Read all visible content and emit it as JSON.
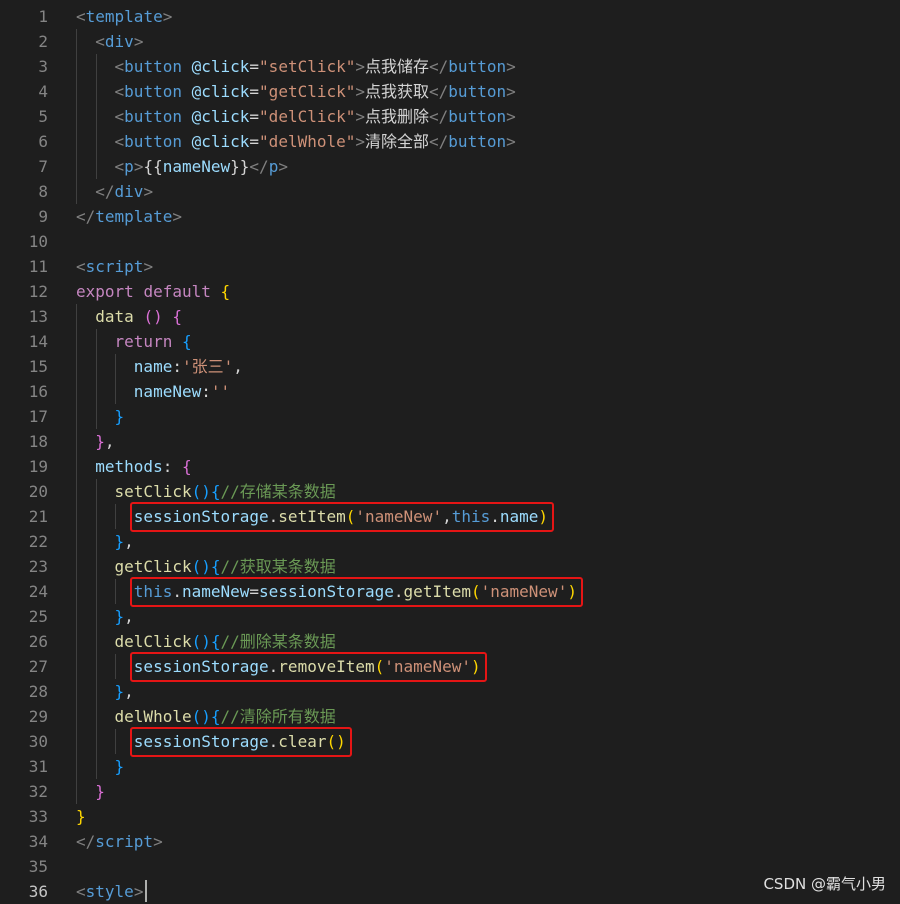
{
  "editor": {
    "lines": [
      {
        "n": "1",
        "t": [
          [
            "<",
            "punc"
          ],
          [
            "template",
            "tag"
          ],
          [
            ">",
            "punc"
          ]
        ]
      },
      {
        "n": "2",
        "t": [
          [
            "  ",
            "text"
          ],
          [
            "<",
            "punc"
          ],
          [
            "div",
            "tag"
          ],
          [
            ">",
            "punc"
          ]
        ]
      },
      {
        "n": "3",
        "t": [
          [
            "    ",
            "text"
          ],
          [
            "<",
            "punc"
          ],
          [
            "button",
            "tag"
          ],
          [
            " ",
            "text"
          ],
          [
            "@click",
            "attr"
          ],
          [
            "=",
            "text"
          ],
          [
            "\"setClick\"",
            "str"
          ],
          [
            ">",
            "punc"
          ],
          [
            "点我储存",
            "text"
          ],
          [
            "</",
            "punc"
          ],
          [
            "button",
            "tag"
          ],
          [
            ">",
            "punc"
          ]
        ]
      },
      {
        "n": "4",
        "t": [
          [
            "    ",
            "text"
          ],
          [
            "<",
            "punc"
          ],
          [
            "button",
            "tag"
          ],
          [
            " ",
            "text"
          ],
          [
            "@click",
            "attr"
          ],
          [
            "=",
            "text"
          ],
          [
            "\"getClick\"",
            "str"
          ],
          [
            ">",
            "punc"
          ],
          [
            "点我获取",
            "text"
          ],
          [
            "</",
            "punc"
          ],
          [
            "button",
            "tag"
          ],
          [
            ">",
            "punc"
          ]
        ]
      },
      {
        "n": "5",
        "t": [
          [
            "    ",
            "text"
          ],
          [
            "<",
            "punc"
          ],
          [
            "button",
            "tag"
          ],
          [
            " ",
            "text"
          ],
          [
            "@click",
            "attr"
          ],
          [
            "=",
            "text"
          ],
          [
            "\"delClick\"",
            "str"
          ],
          [
            ">",
            "punc"
          ],
          [
            "点我删除",
            "text"
          ],
          [
            "</",
            "punc"
          ],
          [
            "button",
            "tag"
          ],
          [
            ">",
            "punc"
          ]
        ]
      },
      {
        "n": "6",
        "t": [
          [
            "    ",
            "text"
          ],
          [
            "<",
            "punc"
          ],
          [
            "button",
            "tag"
          ],
          [
            " ",
            "text"
          ],
          [
            "@click",
            "attr"
          ],
          [
            "=",
            "text"
          ],
          [
            "\"delWhole\"",
            "str"
          ],
          [
            ">",
            "punc"
          ],
          [
            "清除全部",
            "text"
          ],
          [
            "</",
            "punc"
          ],
          [
            "button",
            "tag"
          ],
          [
            ">",
            "punc"
          ]
        ]
      },
      {
        "n": "7",
        "t": [
          [
            "    ",
            "text"
          ],
          [
            "<",
            "punc"
          ],
          [
            "p",
            "tag"
          ],
          [
            ">",
            "punc"
          ],
          [
            "{{",
            "text"
          ],
          [
            "nameNew",
            "var"
          ],
          [
            "}}",
            "text"
          ],
          [
            "</",
            "punc"
          ],
          [
            "p",
            "tag"
          ],
          [
            ">",
            "punc"
          ]
        ]
      },
      {
        "n": "8",
        "t": [
          [
            "  ",
            "text"
          ],
          [
            "</",
            "punc"
          ],
          [
            "div",
            "tag"
          ],
          [
            ">",
            "punc"
          ]
        ]
      },
      {
        "n": "9",
        "t": [
          [
            "</",
            "punc"
          ],
          [
            "template",
            "tag"
          ],
          [
            ">",
            "punc"
          ]
        ]
      },
      {
        "n": "10",
        "t": []
      },
      {
        "n": "11",
        "t": [
          [
            "<",
            "punc"
          ],
          [
            "script",
            "tag"
          ],
          [
            ">",
            "punc"
          ]
        ]
      },
      {
        "n": "12",
        "t": [
          [
            "export",
            "kw"
          ],
          [
            " ",
            "text"
          ],
          [
            "default",
            "kw"
          ],
          [
            " ",
            "text"
          ],
          [
            "{",
            "b1"
          ]
        ]
      },
      {
        "n": "13",
        "t": [
          [
            "  ",
            "text"
          ],
          [
            "data",
            "fn"
          ],
          [
            " ",
            "text"
          ],
          [
            "()",
            "b2"
          ],
          [
            " ",
            "text"
          ],
          [
            "{",
            "b2"
          ]
        ]
      },
      {
        "n": "14",
        "t": [
          [
            "    ",
            "text"
          ],
          [
            "return",
            "kw"
          ],
          [
            " ",
            "text"
          ],
          [
            "{",
            "b3"
          ]
        ]
      },
      {
        "n": "15",
        "t": [
          [
            "      ",
            "text"
          ],
          [
            "name",
            "var"
          ],
          [
            ":",
            "text"
          ],
          [
            "'张三'",
            "str"
          ],
          [
            ",",
            "text"
          ]
        ]
      },
      {
        "n": "16",
        "t": [
          [
            "      ",
            "text"
          ],
          [
            "nameNew",
            "var"
          ],
          [
            ":",
            "text"
          ],
          [
            "''",
            "str"
          ]
        ]
      },
      {
        "n": "17",
        "t": [
          [
            "    ",
            "text"
          ],
          [
            "}",
            "b3"
          ]
        ]
      },
      {
        "n": "18",
        "t": [
          [
            "  ",
            "text"
          ],
          [
            "}",
            "b2"
          ],
          [
            ",",
            "text"
          ]
        ]
      },
      {
        "n": "19",
        "t": [
          [
            "  ",
            "text"
          ],
          [
            "methods",
            "var"
          ],
          [
            ": ",
            "text"
          ],
          [
            "{",
            "b2"
          ]
        ]
      },
      {
        "n": "20",
        "t": [
          [
            "    ",
            "text"
          ],
          [
            "setClick",
            "fn"
          ],
          [
            "()",
            "b3"
          ],
          [
            "{",
            "b3"
          ],
          [
            "//存储某条数据",
            "com"
          ]
        ]
      },
      {
        "n": "21",
        "t": [
          [
            "      ",
            "text"
          ],
          [
            "sessionStorage",
            "var"
          ],
          [
            ".",
            "text"
          ],
          [
            "setItem",
            "fn"
          ],
          [
            "(",
            "b1"
          ],
          [
            "'nameNew'",
            "str"
          ],
          [
            ",",
            "text"
          ],
          [
            "this",
            "kwb"
          ],
          [
            ".",
            "text"
          ],
          [
            "name",
            "var"
          ],
          [
            ")",
            "b1"
          ]
        ]
      },
      {
        "n": "22",
        "t": [
          [
            "    ",
            "text"
          ],
          [
            "}",
            "b3"
          ],
          [
            ",",
            "text"
          ]
        ]
      },
      {
        "n": "23",
        "t": [
          [
            "    ",
            "text"
          ],
          [
            "getClick",
            "fn"
          ],
          [
            "()",
            "b3"
          ],
          [
            "{",
            "b3"
          ],
          [
            "//获取某条数据",
            "com"
          ]
        ]
      },
      {
        "n": "24",
        "t": [
          [
            "      ",
            "text"
          ],
          [
            "this",
            "kwb"
          ],
          [
            ".",
            "text"
          ],
          [
            "nameNew",
            "var"
          ],
          [
            "=",
            "text"
          ],
          [
            "sessionStorage",
            "var"
          ],
          [
            ".",
            "text"
          ],
          [
            "getItem",
            "fn"
          ],
          [
            "(",
            "b1"
          ],
          [
            "'nameNew'",
            "str"
          ],
          [
            ")",
            "b1"
          ]
        ]
      },
      {
        "n": "25",
        "t": [
          [
            "    ",
            "text"
          ],
          [
            "}",
            "b3"
          ],
          [
            ",",
            "text"
          ]
        ]
      },
      {
        "n": "26",
        "t": [
          [
            "    ",
            "text"
          ],
          [
            "delClick",
            "fn"
          ],
          [
            "()",
            "b3"
          ],
          [
            "{",
            "b3"
          ],
          [
            "//删除某条数据",
            "com"
          ]
        ]
      },
      {
        "n": "27",
        "t": [
          [
            "      ",
            "text"
          ],
          [
            "sessionStorage",
            "var"
          ],
          [
            ".",
            "text"
          ],
          [
            "removeItem",
            "fn"
          ],
          [
            "(",
            "b1"
          ],
          [
            "'nameNew'",
            "str"
          ],
          [
            ")",
            "b1"
          ]
        ]
      },
      {
        "n": "28",
        "t": [
          [
            "    ",
            "text"
          ],
          [
            "}",
            "b3"
          ],
          [
            ",",
            "text"
          ]
        ]
      },
      {
        "n": "29",
        "t": [
          [
            "    ",
            "text"
          ],
          [
            "delWhole",
            "fn"
          ],
          [
            "()",
            "b3"
          ],
          [
            "{",
            "b3"
          ],
          [
            "//清除所有数据",
            "com"
          ]
        ]
      },
      {
        "n": "30",
        "t": [
          [
            "      ",
            "text"
          ],
          [
            "sessionStorage",
            "var"
          ],
          [
            ".",
            "text"
          ],
          [
            "clear",
            "fn"
          ],
          [
            "()",
            "b1"
          ]
        ]
      },
      {
        "n": "31",
        "t": [
          [
            "    ",
            "text"
          ],
          [
            "}",
            "b3"
          ]
        ]
      },
      {
        "n": "32",
        "t": [
          [
            "  ",
            "text"
          ],
          [
            "}",
            "b2"
          ]
        ]
      },
      {
        "n": "33",
        "t": [
          [
            "}",
            "b1"
          ]
        ]
      },
      {
        "n": "34",
        "t": [
          [
            "</",
            "punc"
          ],
          [
            "script",
            "tag"
          ],
          [
            ">",
            "punc"
          ]
        ]
      },
      {
        "n": "35",
        "t": []
      },
      {
        "n": "36",
        "t": [
          [
            "<",
            "punc"
          ],
          [
            "style",
            "tag"
          ],
          [
            ">",
            "punc"
          ]
        ],
        "active": true
      }
    ],
    "highlighted_lines": [
      "21",
      "24",
      "27",
      "30"
    ]
  },
  "watermark": "CSDN @霸气小男"
}
